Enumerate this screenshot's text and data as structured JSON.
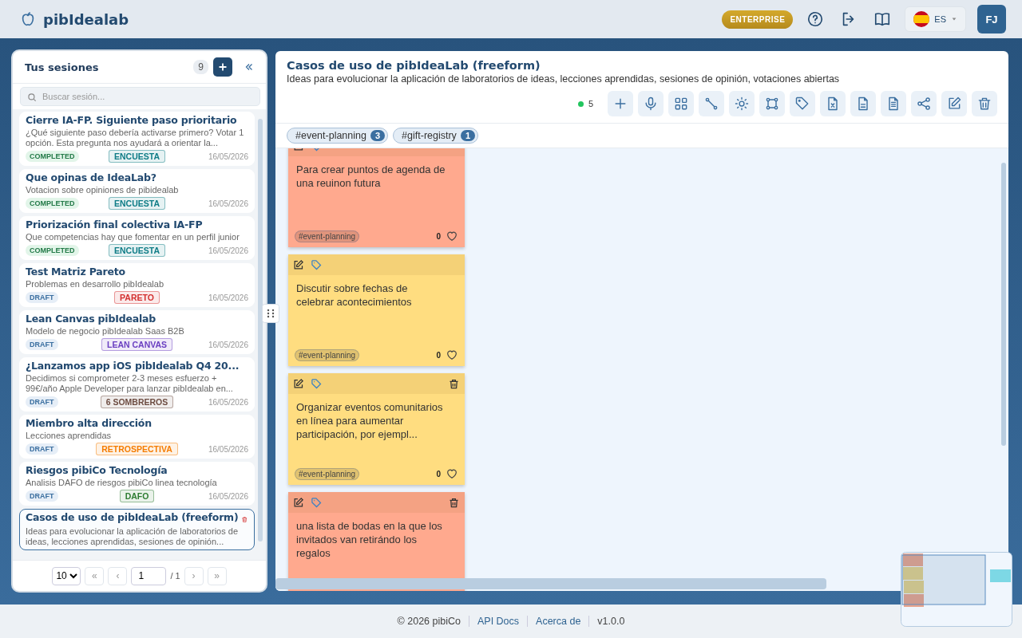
{
  "header": {
    "brand": "pibIdealab",
    "plan_badge": "ENTERPRISE",
    "language": "ES",
    "avatar_initials": "FJ"
  },
  "sidebar": {
    "title": "Tus sesiones",
    "count": "9",
    "search": {
      "placeholder": "Buscar sesión..."
    },
    "sessions": [
      {
        "title": "Cierre IA-FP. Siguiente paso prioritario",
        "description": "¿Qué siguiente paso debería activarse primero? Votar 1 opción. Esta pregunta nos ayudará a orientar la...",
        "status": {
          "label": "COMPLETED",
          "kind": "completed"
        },
        "type": {
          "label": "ENCUESTA",
          "color": "#0e7c86"
        },
        "date": "16/05/2026",
        "selected": false
      },
      {
        "title": "Que opinas de IdeaLab?",
        "description": "Votacion sobre opiniones de pibidealab",
        "status": {
          "label": "COMPLETED",
          "kind": "completed"
        },
        "type": {
          "label": "ENCUESTA",
          "color": "#0e7c86"
        },
        "date": "16/05/2026",
        "selected": false
      },
      {
        "title": "Priorización final colectiva IA-FP",
        "description": "Que competencias hay que fomentar en un perfil junior",
        "status": {
          "label": "COMPLETED",
          "kind": "completed"
        },
        "type": {
          "label": "ENCUESTA",
          "color": "#0e7c86"
        },
        "date": "16/05/2026",
        "selected": false
      },
      {
        "title": "Test Matriz Pareto",
        "description": "Problemas en desarrollo pibIdealab",
        "status": {
          "label": "DRAFT",
          "kind": "draft"
        },
        "type": {
          "label": "PARETO",
          "color": "#d32f2f"
        },
        "date": "16/05/2026",
        "selected": false
      },
      {
        "title": "Lean Canvas pibIdealab",
        "description": "Modelo de negocio pibIdealab Saas B2B",
        "status": {
          "label": "DRAFT",
          "kind": "draft"
        },
        "type": {
          "label": "LEAN CANVAS",
          "color": "#6a3fc1"
        },
        "date": "16/05/2026",
        "selected": false
      },
      {
        "title": "¿Lanzamos app iOS pibIdealab Q4 20...",
        "description": "Decidimos si comprometer 2-3 meses esfuerzo + 99€/año Apple Developer para lanzar pibIdealab en...",
        "status": {
          "label": "DRAFT",
          "kind": "draft"
        },
        "type": {
          "label": "6 SOMBREROS",
          "color": "#6d4c41"
        },
        "date": "16/05/2026",
        "selected": false
      },
      {
        "title": "Miembro alta dirección",
        "description": "Lecciones aprendidas",
        "status": {
          "label": "DRAFT",
          "kind": "draft"
        },
        "type": {
          "label": "RETROSPECTIVA",
          "color": "#f57c00"
        },
        "date": "16/05/2026",
        "selected": false
      },
      {
        "title": "Riesgos pibiCo Tecnología",
        "description": "Analisis DAFO de riesgos pibiCo linea tecnología",
        "status": {
          "label": "DRAFT",
          "kind": "draft"
        },
        "type": {
          "label": "DAFO",
          "color": "#2e7d32"
        },
        "date": "16/05/2026",
        "selected": false
      },
      {
        "title": "Casos de uso de pibIdeaLab (freeform)",
        "description": "Ideas para evolucionar la aplicación de laboratorios de ideas, lecciones aprendidas, sesiones de opinión...",
        "selected": true
      }
    ],
    "pagination": {
      "page_size": "10",
      "first": "«",
      "prev": "‹",
      "page": "1",
      "total": "/ 1",
      "next": "›",
      "last": "»"
    }
  },
  "board": {
    "title": "Casos de uso de pibIdeaLab (freeform)",
    "subtitle": "Ideas para evolucionar la aplicación de laboratorios de ideas, lecciones aprendidas, sesiones de opinión, votaciones abiertas",
    "online_count": "5",
    "tag_filters": [
      {
        "label": "#event-planning",
        "count": "3"
      },
      {
        "label": "#gift-registry",
        "count": "1"
      }
    ],
    "notes": [
      {
        "text": "Para crear puntos de agenda de una reuinon futura",
        "tag": "#event-planning",
        "votes": "0",
        "color": "#ffa98e",
        "deletable": false
      },
      {
        "text": "Discutir sobre fechas de celebrar acontecimientos",
        "tag": "#event-planning",
        "votes": "0",
        "color": "#ffdd80",
        "deletable": false
      },
      {
        "text": "Organizar eventos comunitarios en línea para aumentar participación, por ejempl...",
        "tag": "#event-planning",
        "votes": "0",
        "color": "#ffdd80",
        "deletable": true
      },
      {
        "text": "una lista de bodas en la que los invitados van retirándo los regalos",
        "color": "#ffa98e",
        "deletable": true
      }
    ]
  },
  "footer": {
    "copyright": "© 2026 pibiCo",
    "links": [
      "API Docs",
      "Acerca de"
    ],
    "version": "v1.0.0"
  }
}
